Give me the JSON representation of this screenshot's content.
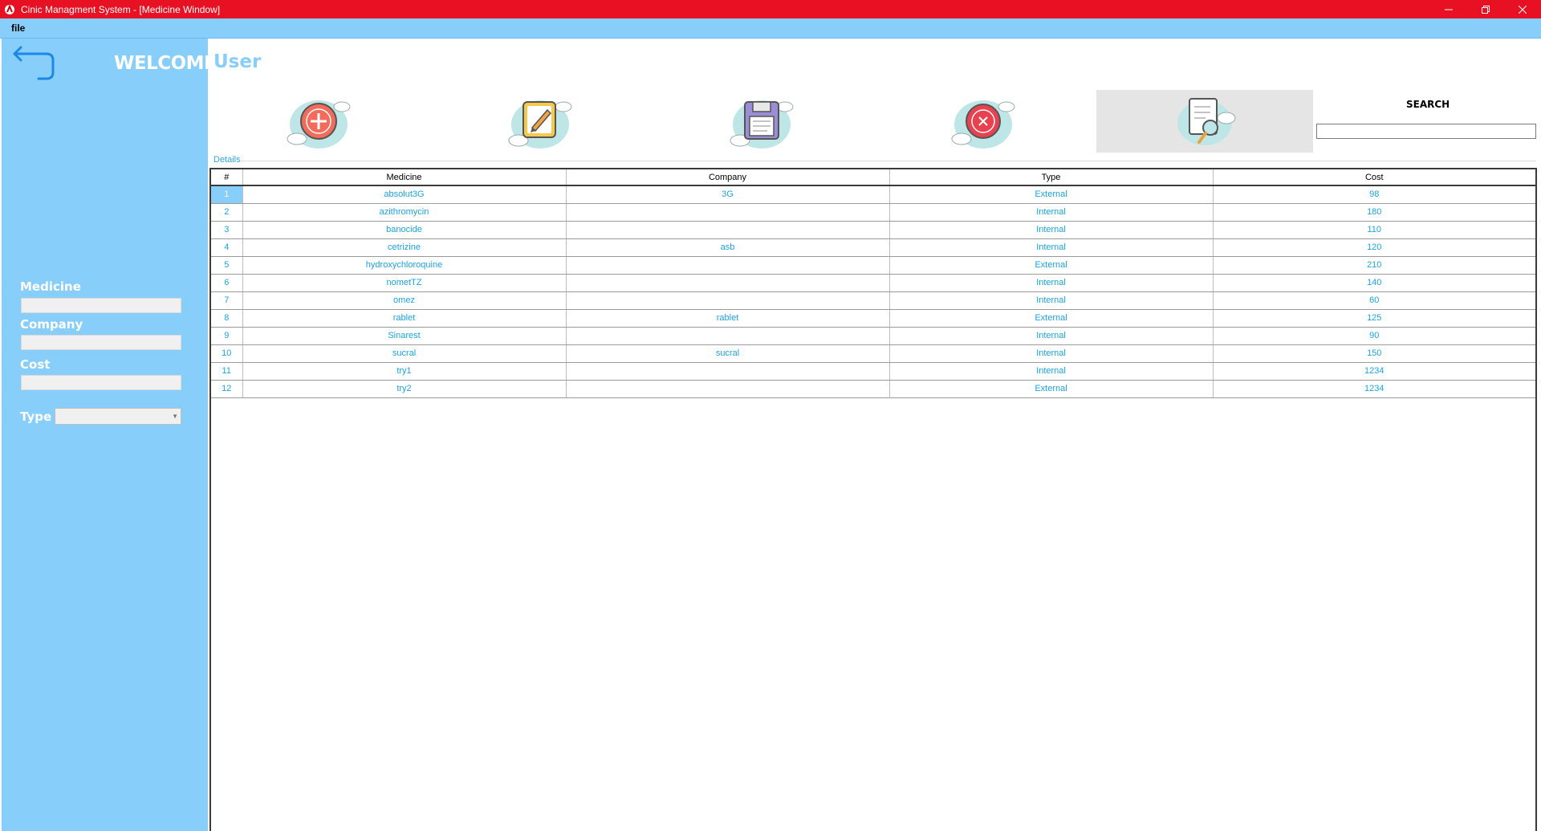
{
  "window": {
    "title": "Cinic Managment System - [Medicine Window]",
    "accent_color": "#e81123"
  },
  "menu": {
    "file_label": "file"
  },
  "sidebar": {
    "welcome": "WELCOME",
    "background_color": "#87cefa",
    "fields": {
      "medicine_label": "Medicine",
      "medicine_value": "",
      "company_label": "Company",
      "company_value": "",
      "cost_label": "Cost",
      "cost_value": "",
      "type_label": "Type",
      "type_value": ""
    }
  },
  "header": {
    "user": "User"
  },
  "toolbar": {
    "buttons": [
      {
        "icon": "add-icon"
      },
      {
        "icon": "edit-icon"
      },
      {
        "icon": "save-icon"
      },
      {
        "icon": "delete-icon"
      },
      {
        "icon": "search-document-icon",
        "active": true
      }
    ],
    "search_label": "SEARCH",
    "search_value": ""
  },
  "details": {
    "legend": "Details",
    "columns": [
      "#",
      "Medicine",
      "Company",
      "Type",
      "Cost"
    ],
    "rows": [
      {
        "num": "1",
        "medicine": "absolut3G",
        "company": "3G",
        "type": "External",
        "cost": "98",
        "selected": true
      },
      {
        "num": "2",
        "medicine": "azithromycin",
        "company": "",
        "type": "Internal",
        "cost": "180"
      },
      {
        "num": "3",
        "medicine": "banocide",
        "company": "",
        "type": "Internal",
        "cost": "110"
      },
      {
        "num": "4",
        "medicine": "cetrizine",
        "company": "asb",
        "type": "Internal",
        "cost": "120"
      },
      {
        "num": "5",
        "medicine": "hydroxychloroquine",
        "company": "",
        "type": "External",
        "cost": "210"
      },
      {
        "num": "6",
        "medicine": "nometTZ",
        "company": "",
        "type": "Internal",
        "cost": "140"
      },
      {
        "num": "7",
        "medicine": "omez",
        "company": "",
        "type": "Internal",
        "cost": "60"
      },
      {
        "num": "8",
        "medicine": "rablet",
        "company": "rablet",
        "type": "External",
        "cost": "125"
      },
      {
        "num": "9",
        "medicine": "Sinarest",
        "company": "",
        "type": "Internal",
        "cost": "90"
      },
      {
        "num": "10",
        "medicine": "sucral",
        "company": "sucral",
        "type": "Internal",
        "cost": "150"
      },
      {
        "num": "11",
        "medicine": "try1",
        "company": "",
        "type": "Internal",
        "cost": "1234"
      },
      {
        "num": "12",
        "medicine": "try2",
        "company": "",
        "type": "External",
        "cost": "1234"
      }
    ]
  }
}
